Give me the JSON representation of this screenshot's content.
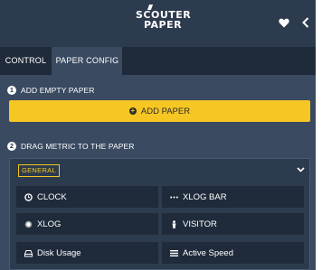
{
  "header": {
    "logo_line1": "SCOUTER",
    "logo_line2": "PAPER"
  },
  "tabs": [
    {
      "label": "CONTROL",
      "active": false
    },
    {
      "label": "PAPER CONFIG",
      "active": true
    }
  ],
  "step1": {
    "number": "1",
    "title": "ADD EMPTY PAPER",
    "button_label": "ADD PAPER"
  },
  "step2": {
    "number": "2",
    "title": "DRAG METRIC TO THE PAPER"
  },
  "group": {
    "label": "GENERAL"
  },
  "metrics": [
    {
      "label": "CLOCK",
      "icon": "clock-icon"
    },
    {
      "label": "XLOG BAR",
      "icon": "ellipsis-icon"
    },
    {
      "label": "XLOG",
      "icon": "dot-circle-icon"
    },
    {
      "label": "VISITOR",
      "icon": "person-icon"
    },
    {
      "label": "Disk Usage",
      "icon": "hdd-icon"
    },
    {
      "label": "Active Speed",
      "icon": "bars-icon"
    }
  ],
  "colors": {
    "accent": "#f6c623",
    "background": "#394a61",
    "topbar": "#2d3b4e",
    "tabbar": "#1f2b3a"
  }
}
